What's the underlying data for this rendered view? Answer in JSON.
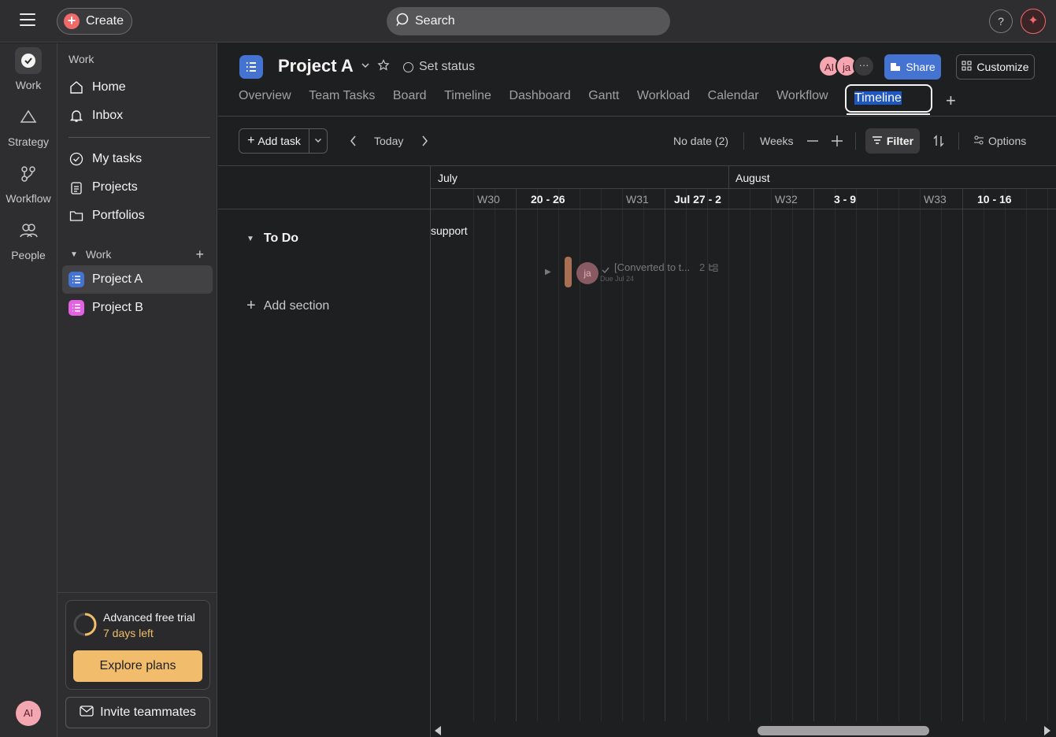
{
  "topbar": {
    "create_label": "Create",
    "search_label": "Search",
    "help_label": "?"
  },
  "rail": {
    "items": [
      {
        "label": "Work"
      },
      {
        "label": "Strategy"
      },
      {
        "label": "Workflow"
      },
      {
        "label": "People"
      }
    ],
    "user_initials": "AI"
  },
  "sidebar": {
    "section_work": "Work",
    "home": "Home",
    "inbox": "Inbox",
    "my_tasks": "My tasks",
    "projects": "Projects",
    "portfolios": "Portfolios",
    "work_group": "Work",
    "project_items": [
      {
        "label": "Project A",
        "color": "#4573d2"
      },
      {
        "label": "Project B",
        "color": "#e362e3"
      }
    ],
    "trial_title": "Advanced free trial",
    "trial_days": "7 days left",
    "explore_label": "Explore plans",
    "invite_label": "Invite teammates"
  },
  "header": {
    "project_title": "Project A",
    "set_status": "Set status",
    "members": [
      "AI",
      "ja"
    ],
    "share_label": "Share",
    "customize_label": "Customize",
    "tabs": [
      "Overview",
      "Team Tasks",
      "Board",
      "Timeline",
      "Dashboard",
      "Gantt",
      "Workload",
      "Calendar",
      "Workflow"
    ],
    "editing_tab_value": "Timeline"
  },
  "toolbar": {
    "add_task": "Add task",
    "today": "Today",
    "no_date": "No date (2)",
    "weeks": "Weeks",
    "filter": "Filter",
    "options": "Options"
  },
  "timeline": {
    "months": [
      "July",
      "August"
    ],
    "weeks": [
      {
        "num": "W30",
        "range": "20 - 26"
      },
      {
        "num": "W31",
        "range": "Jul 27 - 2"
      },
      {
        "num": "W32",
        "range": "3 - 9"
      },
      {
        "num": "W33",
        "range": "10 - 16"
      }
    ],
    "partial_label": "support",
    "section_name": "To Do",
    "add_section": "Add section",
    "task": {
      "assignee": "ja",
      "title": "[Converted to t...",
      "subtask_count": "2",
      "due": "Due Jul 24",
      "color": "#c27e5b"
    }
  }
}
